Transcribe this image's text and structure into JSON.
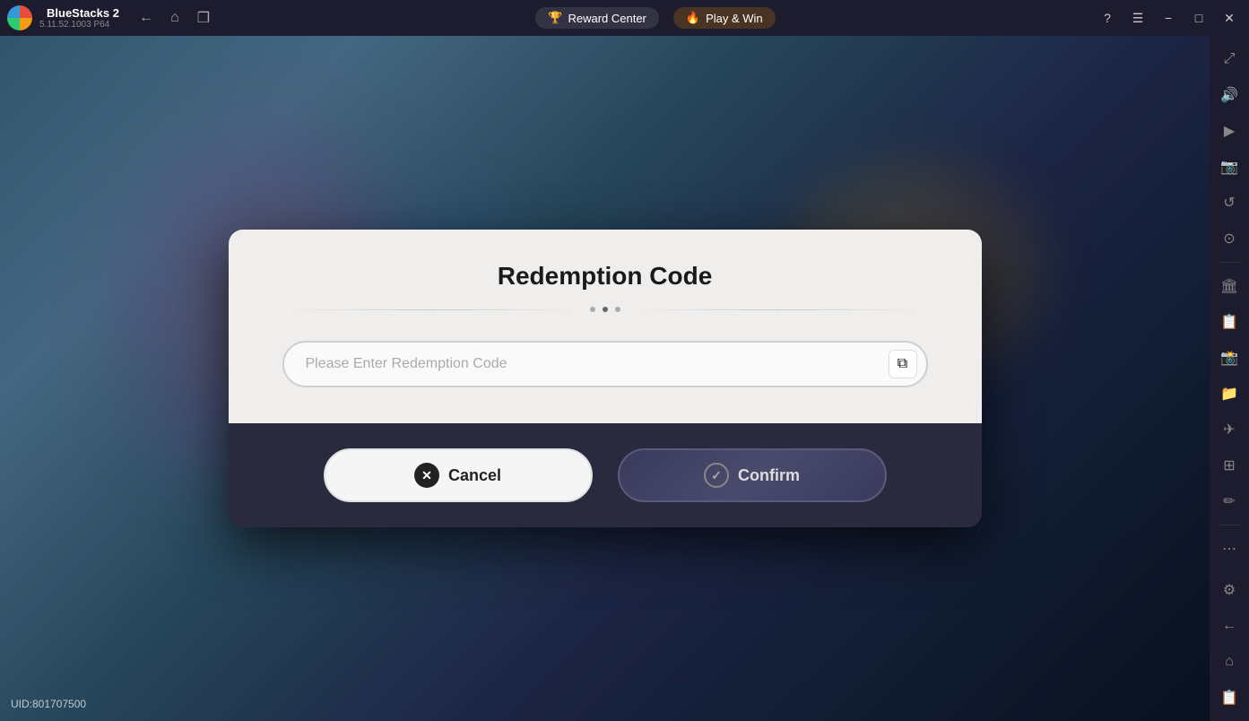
{
  "app": {
    "name": "BlueStacks 2",
    "version": "5.11.52.1003",
    "arch": "P64"
  },
  "topbar": {
    "back_label": "←",
    "home_label": "⌂",
    "multi_label": "❒",
    "reward_label": "Reward Center",
    "reward_icon": "🏆",
    "play_label": "Play & Win",
    "play_icon": "🔥",
    "help_icon": "?",
    "menu_icon": "☰",
    "minimize_icon": "−",
    "restore_icon": "□",
    "close_icon": "✕",
    "expand_icon": "⤢"
  },
  "sidebar": {
    "items": [
      {
        "icon": "⤢",
        "name": "fullscreen-icon"
      },
      {
        "icon": "🔊",
        "name": "volume-icon"
      },
      {
        "icon": "▶",
        "name": "play-icon"
      },
      {
        "icon": "📷",
        "name": "camera-icon"
      },
      {
        "icon": "↺",
        "name": "rotate-icon"
      },
      {
        "icon": "⊙",
        "name": "record-icon"
      },
      {
        "icon": "🏛",
        "name": "apps-icon"
      },
      {
        "icon": "📋",
        "name": "clipboard-icon"
      },
      {
        "icon": "📸",
        "name": "screenshot-icon"
      },
      {
        "icon": "📁",
        "name": "folder-icon"
      },
      {
        "icon": "✈",
        "name": "airplane-icon"
      },
      {
        "icon": "⊞",
        "name": "grid-icon"
      },
      {
        "icon": "✏",
        "name": "edit-icon"
      },
      {
        "icon": "⊕",
        "name": "add-icon"
      },
      {
        "icon": "⋯",
        "name": "more-icon"
      },
      {
        "icon": "⚙",
        "name": "settings-icon"
      },
      {
        "icon": "←",
        "name": "back-icon"
      },
      {
        "icon": "⌂",
        "name": "home-bottom-icon"
      },
      {
        "icon": "📋",
        "name": "clipboard-bottom-icon"
      }
    ]
  },
  "dialog": {
    "title": "Redemption Code",
    "input_placeholder": "Please Enter Redemption Code",
    "cancel_label": "Cancel",
    "confirm_label": "Confirm",
    "paste_icon": "📋"
  },
  "footer": {
    "uid_label": "UID:801707500"
  }
}
